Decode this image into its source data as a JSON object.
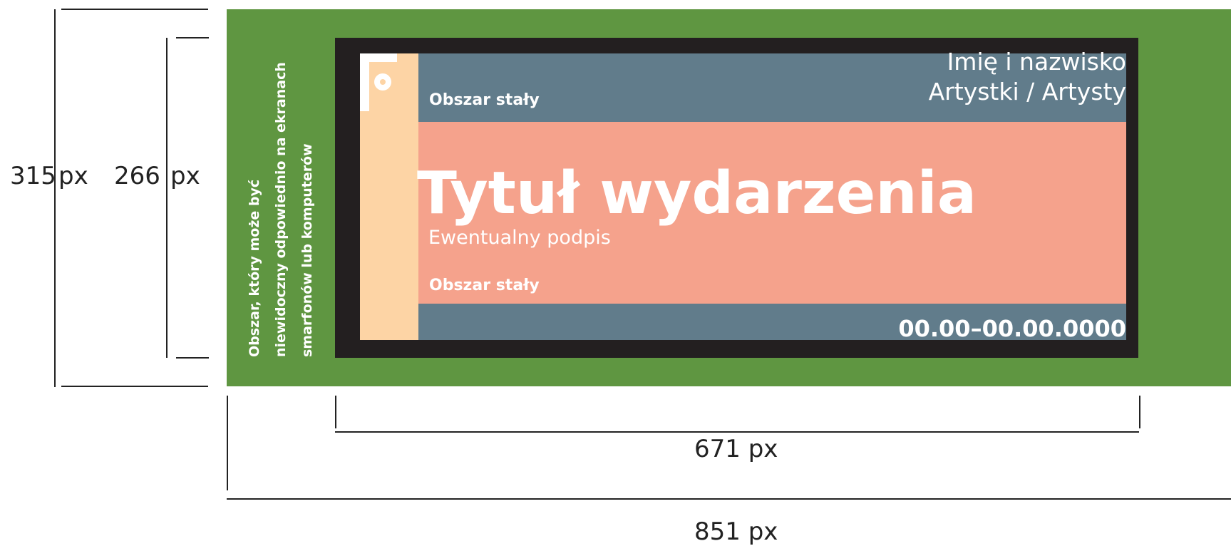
{
  "dimensions": {
    "outer_height": "315",
    "inner_height": "266",
    "inner_width": "671 px",
    "outer_width": "851 px",
    "unit": "px"
  },
  "safe_area_note": {
    "line1": "Obszar, który może być",
    "line2": "niewidoczny odpowiednio na ekranach",
    "line3": "smarfonów lub komputerów"
  },
  "banner": {
    "fixed_area_top": "Obszar stały",
    "artist_line1": "Imię i nazwisko",
    "artist_line2": "Artystki / Artysty",
    "event_title": "Tytuł wydarzenia",
    "subtitle": "Ewentualny podpis",
    "fixed_area_bottom": "Obszar stały",
    "date": "00.00–00.00.0000"
  },
  "colors": {
    "green_area": "#5f9641",
    "frame": "#231f20",
    "peach_strip": "#fdd4a5",
    "slate_bands": "#617c8b",
    "salmon": "#f5a28c"
  }
}
